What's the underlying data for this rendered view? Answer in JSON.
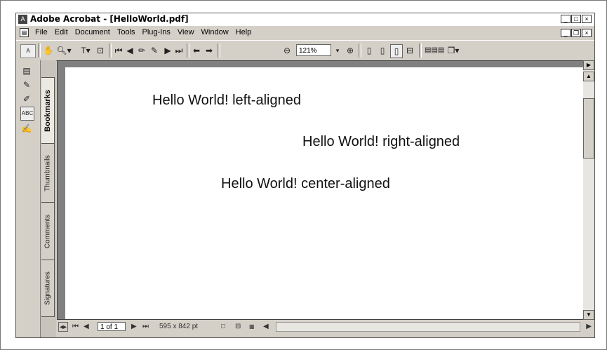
{
  "window": {
    "title": "Adobe Acrobat - [HelloWorld.pdf]"
  },
  "menu": [
    "File",
    "Edit",
    "Document",
    "Tools",
    "Plug-Ins",
    "View",
    "Window",
    "Help"
  ],
  "toolbar": {
    "zoom": "121%"
  },
  "tabs": [
    "Bookmarks",
    "Thumbnails",
    "Comments",
    "Signatures"
  ],
  "page": {
    "lines": [
      "Hello World! left-aligned",
      "Hello World! right-aligned",
      "Hello World! center-aligned"
    ]
  },
  "status": {
    "page": "1 of 1",
    "size": "595 x 842 pt"
  }
}
